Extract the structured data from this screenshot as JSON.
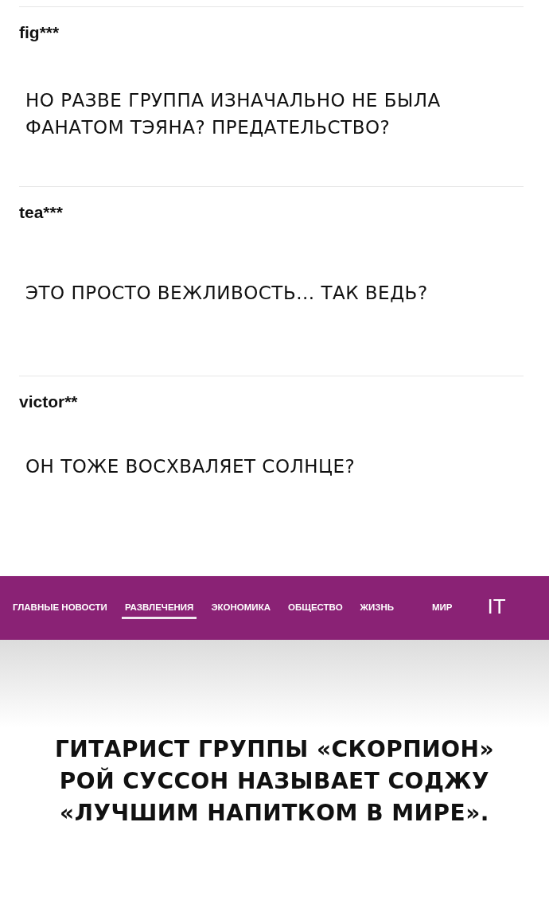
{
  "comments": [
    {
      "user": "fig***",
      "text": "НО РАЗВЕ ГРУППА ИЗНАЧАЛЬНО НЕ БЫЛА ФАНАТОМ ТЭЯНА? ПРЕДАТЕЛЬСТВО?"
    },
    {
      "user": "tea***",
      "text": "ЭТО ПРОСТО ВЕЖЛИВОСТЬ... ТАК ВЕДЬ?"
    },
    {
      "user": "victor**",
      "text": "ОН ТОЖЕ ВОСХВАЛЯЕТ СОЛНЦЕ?"
    }
  ],
  "tabs": [
    {
      "label": "ГЛАВНЫЕ НОВОСТИ",
      "selected": false
    },
    {
      "label": "РАЗВЛЕЧЕНИЯ",
      "selected": true
    },
    {
      "label": "ЭКОНОМИКА",
      "selected": false
    },
    {
      "label": "ОБЩЕСТВО",
      "selected": false
    },
    {
      "label": "ЖИЗНЬ",
      "selected": false
    },
    {
      "label": "МИР",
      "selected": false
    },
    {
      "label": "IT",
      "selected": false
    }
  ],
  "headline": "ГИТАРИСТ ГРУППЫ «СКОРПИОН» РОЙ СУССОН НАЗЫВАЕТ СОДЖУ «ЛУЧШИМ НАПИТКОМ В МИРЕ»."
}
